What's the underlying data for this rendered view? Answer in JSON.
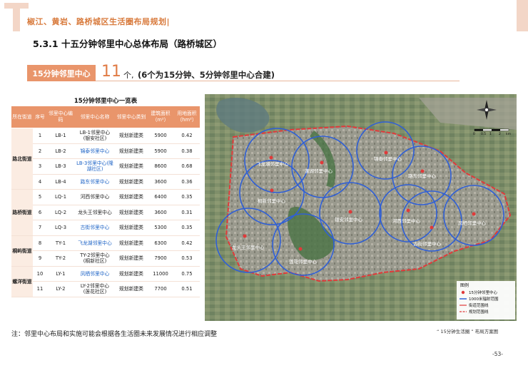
{
  "header": {
    "title": "椒江、黄岩、路桥城区生活圈布局规划|"
  },
  "section": {
    "title": "5.3.1 十五分钟邻里中心总体布局（路桥城区）"
  },
  "summary": {
    "tag": "15分钟邻里中心",
    "count": "11",
    "unit": "个,",
    "note": "(6个为15分钟、5分钟邻里中心合建)"
  },
  "table": {
    "title": "15分钟邻里中心一览表",
    "headers": [
      "所在街道",
      "序号",
      "邻里中心编码",
      "邻里中心名称",
      "邻里中心类别",
      "建筑面积（m²）",
      "用地面积（hm²）"
    ],
    "rows": [
      {
        "street": "路北街道",
        "rowspan": 4,
        "no": "1",
        "code": "LB-1",
        "name": "LB-1邻里中心",
        "sub": "(银安社区)",
        "type": "规划新建类",
        "area": "5900",
        "land": "0.42"
      },
      {
        "no": "2",
        "code": "LB-2",
        "name": "",
        "sub": "锦泰邻里中心",
        "type": "规划新建类",
        "area": "5900",
        "land": "0.38"
      },
      {
        "no": "3",
        "code": "LB-3",
        "name": "",
        "sub": "LB-3邻里中心(隆湖社区)",
        "type": "规划新建类",
        "area": "8600",
        "land": "0.68"
      },
      {
        "no": "4",
        "code": "LB-4",
        "name": "",
        "sub": "路东邻里中心",
        "type": "规划新建类",
        "area": "3600",
        "land": "0.36"
      },
      {
        "street": "路桥街道",
        "rowspan": 3,
        "no": "5",
        "code": "LQ-1",
        "name": "河西邻里中心",
        "sub": "",
        "type": "规划新建类",
        "area": "6400",
        "land": "0.35"
      },
      {
        "no": "6",
        "code": "LQ-2",
        "name": "龙头王邻里中心",
        "sub": "",
        "type": "规划新建类",
        "area": "3600",
        "land": "0.31"
      },
      {
        "no": "7",
        "code": "LQ-3",
        "name": "",
        "sub": "古街邻里中心",
        "type": "规划新建类",
        "area": "5300",
        "land": "0.35"
      },
      {
        "street": "桐屿街道",
        "rowspan": 2,
        "no": "8",
        "code": "TY-1",
        "name": "",
        "sub": "飞龙湖邻里中心",
        "type": "规划新建类",
        "area": "6300",
        "land": "0.42"
      },
      {
        "no": "9",
        "code": "TY-2",
        "name": "TY-2邻里中心",
        "sub": "(桐新社区)",
        "type": "规划新建类",
        "area": "7900",
        "land": "0.53"
      },
      {
        "street": "螺洋街道",
        "rowspan": 2,
        "no": "10",
        "code": "LY-1",
        "name": "",
        "sub": "凤栖邻里中心",
        "type": "规划新建类",
        "area": "11000",
        "land": "0.75"
      },
      {
        "no": "11",
        "code": "LY-2",
        "name": "LY-2邻里中心",
        "sub": "(莲花社区)",
        "type": "规划新建类",
        "area": "7700",
        "land": "0.51"
      }
    ]
  },
  "map": {
    "centers": [
      {
        "code": "LB-1",
        "label": "飞龙湖邻里中心"
      },
      {
        "code": "LB-2",
        "label": "蓬湖邻里中心"
      },
      {
        "code": "LB-3",
        "label": "锦泰邻里中心"
      },
      {
        "code": "LB-4",
        "label": "路东邻里中心"
      },
      {
        "code": "TY-1",
        "label": "桐新邻里中心"
      },
      {
        "code": "LQ-1",
        "label": "银安邻里中心"
      },
      {
        "code": "LQ-2",
        "label": "河西邻里中心"
      },
      {
        "code": "LQ-3",
        "label": "古街邻里中心"
      },
      {
        "code": "LY-1",
        "label": "凤栖邻里中心"
      },
      {
        "code": "LY-2",
        "label": "莲花邻里中心"
      },
      {
        "code": "",
        "label": "龙头王邻里中心"
      }
    ],
    "legend": {
      "title": "图例",
      "items": [
        "15分钟邻里中心",
        "1000米辐射范围",
        "街道范围线",
        "规划范围线"
      ]
    },
    "scale_labels": [
      "0",
      "0.5",
      "1",
      "2",
      "km"
    ]
  },
  "note": "注：邻里中心布局和实施可能会根据各生活圈未来发展情况进行相应调整",
  "caption": "“ 15分钟生活圈 ” 布局方案图",
  "page_number": "-53-",
  "colors": {
    "accent": "#e9956b",
    "title": "#d87a3c",
    "circle": "#2f5fd6",
    "boundary": "#e03a3a",
    "link": "#1d63c6"
  }
}
